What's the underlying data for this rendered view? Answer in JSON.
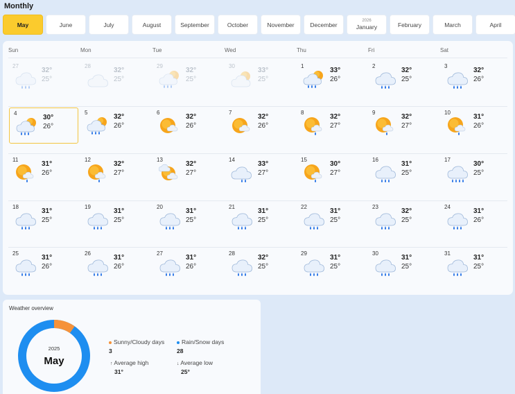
{
  "header": {
    "title": "Monthly"
  },
  "months": [
    {
      "label": "May",
      "year": "",
      "active": true
    },
    {
      "label": "June",
      "year": ""
    },
    {
      "label": "July",
      "year": ""
    },
    {
      "label": "August",
      "year": ""
    },
    {
      "label": "September",
      "year": ""
    },
    {
      "label": "October",
      "year": ""
    },
    {
      "label": "November",
      "year": ""
    },
    {
      "label": "December",
      "year": ""
    },
    {
      "label": "January",
      "year": "2026"
    },
    {
      "label": "February",
      "year": ""
    },
    {
      "label": "March",
      "year": ""
    },
    {
      "label": "April",
      "year": ""
    }
  ],
  "weekdays": [
    "Sun",
    "Mon",
    "Tue",
    "Wed",
    "Thu",
    "Fri",
    "Sat"
  ],
  "days": [
    {
      "d": "27",
      "hi": "32°",
      "lo": "25°",
      "icon": "rain-icon",
      "faded": true
    },
    {
      "d": "28",
      "hi": "32°",
      "lo": "25°",
      "icon": "cloudy-icon",
      "faded": true
    },
    {
      "d": "29",
      "hi": "32°",
      "lo": "25°",
      "icon": "sun-cloud-rain-icon",
      "faded": true
    },
    {
      "d": "30",
      "hi": "33°",
      "lo": "25°",
      "icon": "partly-cloudy-icon",
      "faded": true
    },
    {
      "d": "1",
      "hi": "33°",
      "lo": "26°",
      "icon": "sun-cloud-rain-icon"
    },
    {
      "d": "2",
      "hi": "32°",
      "lo": "25°",
      "icon": "rain-icon"
    },
    {
      "d": "3",
      "hi": "32°",
      "lo": "26°",
      "icon": "rain-icon"
    },
    {
      "d": "4",
      "hi": "30°",
      "lo": "26°",
      "icon": "sun-cloud-rain-icon",
      "today": true
    },
    {
      "d": "5",
      "hi": "32°",
      "lo": "26°",
      "icon": "sun-cloud-rain-icon"
    },
    {
      "d": "6",
      "hi": "32°",
      "lo": "26°",
      "icon": "sun-cloud-icon"
    },
    {
      "d": "7",
      "hi": "32°",
      "lo": "26°",
      "icon": "sun-cloud-icon"
    },
    {
      "d": "8",
      "hi": "32°",
      "lo": "27°",
      "icon": "sun-shower-icon"
    },
    {
      "d": "9",
      "hi": "32°",
      "lo": "27°",
      "icon": "sun-shower-icon"
    },
    {
      "d": "10",
      "hi": "31°",
      "lo": "26°",
      "icon": "sun-shower-icon"
    },
    {
      "d": "11",
      "hi": "31°",
      "lo": "26°",
      "icon": "sun-shower-icon"
    },
    {
      "d": "12",
      "hi": "32°",
      "lo": "27°",
      "icon": "sun-shower-icon"
    },
    {
      "d": "13",
      "hi": "32°",
      "lo": "27°",
      "icon": "sun-behind-cloud-icon"
    },
    {
      "d": "14",
      "hi": "33°",
      "lo": "27°",
      "icon": "cloud-light-rain-icon"
    },
    {
      "d": "15",
      "hi": "30°",
      "lo": "27°",
      "icon": "sun-shower-icon"
    },
    {
      "d": "16",
      "hi": "31°",
      "lo": "25°",
      "icon": "rain-icon"
    },
    {
      "d": "17",
      "hi": "30°",
      "lo": "25°",
      "icon": "heavy-rain-icon"
    },
    {
      "d": "18",
      "hi": "31°",
      "lo": "25°",
      "icon": "rain-icon"
    },
    {
      "d": "19",
      "hi": "31°",
      "lo": "25°",
      "icon": "rain-icon"
    },
    {
      "d": "20",
      "hi": "31°",
      "lo": "25°",
      "icon": "rain-icon"
    },
    {
      "d": "21",
      "hi": "31°",
      "lo": "25°",
      "icon": "rain-icon"
    },
    {
      "d": "22",
      "hi": "31°",
      "lo": "25°",
      "icon": "rain-icon"
    },
    {
      "d": "23",
      "hi": "32°",
      "lo": "25°",
      "icon": "rain-icon"
    },
    {
      "d": "24",
      "hi": "31°",
      "lo": "26°",
      "icon": "rain-icon"
    },
    {
      "d": "25",
      "hi": "31°",
      "lo": "26°",
      "icon": "rain-icon"
    },
    {
      "d": "26",
      "hi": "31°",
      "lo": "26°",
      "icon": "rain-icon"
    },
    {
      "d": "27",
      "hi": "31°",
      "lo": "26°",
      "icon": "rain-icon"
    },
    {
      "d": "28",
      "hi": "32°",
      "lo": "25°",
      "icon": "rain-icon"
    },
    {
      "d": "29",
      "hi": "31°",
      "lo": "25°",
      "icon": "rain-icon"
    },
    {
      "d": "30",
      "hi": "31°",
      "lo": "25°",
      "icon": "rain-icon"
    },
    {
      "d": "31",
      "hi": "31°",
      "lo": "25°",
      "icon": "rain-icon"
    }
  ],
  "overview": {
    "title": "Weather overview",
    "year": "2025",
    "month": "May",
    "sunny_label": "Sunny/Cloudy days",
    "sunny_value": "3",
    "rain_label": "Rain/Snow days",
    "rain_value": "28",
    "avg_high_label": "Average high",
    "avg_high_value": "31°",
    "avg_low_label": "Average low",
    "avg_low_value": "25°",
    "sunny_days": 3,
    "rain_days": 28,
    "sunny_color": "#f5923a",
    "rain_color": "#1e8ef0"
  },
  "colors": {
    "accent": "#fbcb2d",
    "background": "#dde9f8"
  }
}
